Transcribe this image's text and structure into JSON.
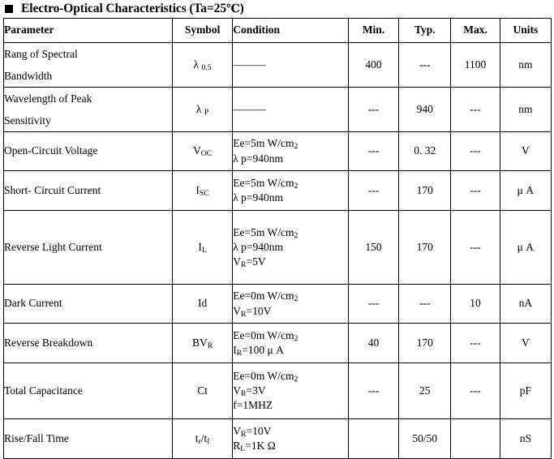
{
  "title": {
    "bullet": "black-square-bullet",
    "text": "Electro-Optical Characteristics (Ta=25℃)",
    "main": "Electro-Optical Characteristics (Ta=25",
    "temp_unit": "℃",
    "close_paren": ")"
  },
  "table": {
    "columns": [
      "Parameter",
      "Symbol",
      "Condition",
      "Min.",
      "Typ.",
      "Max.",
      "Units"
    ],
    "rows": [
      {
        "parameter_lines": [
          "Rang of Spectral",
          "Bandwidth"
        ],
        "symbol_html": "λ <sub>0.5</sub>",
        "symbol_text": "λ 0.5",
        "condition_lines": [
          "———"
        ],
        "min": "400",
        "typ": "---",
        "max": "1100",
        "units": "nm"
      },
      {
        "parameter_lines": [
          "Wavelength of Peak",
          "Sensitivity"
        ],
        "symbol_html": "λ <sub>P</sub>",
        "symbol_text": "λ P",
        "condition_lines": [
          "———"
        ],
        "min": "---",
        "typ": "940",
        "max": "---",
        "units": "nm"
      },
      {
        "parameter_lines": [
          "Open-Circuit Voltage"
        ],
        "symbol_html": "V<sub>OC</sub>",
        "symbol_text": "VOC",
        "condition_lines": [
          "Ee=5m W/cm<sub>2</sub>",
          "λ p=940nm"
        ],
        "min": "---",
        "typ": "0. 32",
        "max": "---",
        "units": "V"
      },
      {
        "parameter_lines": [
          "Short- Circuit Current"
        ],
        "symbol_html": "I<sub>SC</sub>",
        "symbol_text": "ISC",
        "condition_lines": [
          "Ee=5m W/cm<sub>2</sub>",
          "λ p=940nm"
        ],
        "min": "---",
        "typ": "170",
        "max": "---",
        "units": "μ A"
      },
      {
        "parameter_lines": [
          "Reverse Light Current"
        ],
        "symbol_html": "I<sub>L</sub>",
        "symbol_text": "IL",
        "condition_lines": [
          "Ee=5m W/cm<sub>2</sub>",
          "λ p=940nm",
          "V<sub>R</sub>=5V"
        ],
        "min": "150",
        "typ": "170",
        "max": "---",
        "units": "μ A"
      },
      {
        "parameter_lines": [
          "Dark Current"
        ],
        "symbol_html": "Id",
        "symbol_text": "Id",
        "condition_lines": [
          "Ee=0m W/cm<sub>2</sub>",
          "V<sub>R</sub>=10V"
        ],
        "min": "---",
        "typ": "---",
        "max": "10",
        "units": "nA"
      },
      {
        "parameter_lines": [
          "Reverse Breakdown"
        ],
        "symbol_html": "BV<sub>R</sub>",
        "symbol_text": "BVR",
        "condition_lines": [
          "Ee=0m W/cm<sub>2</sub>",
          "I<sub>R</sub>=100 μ A"
        ],
        "min": "40",
        "typ": "170",
        "max": "---",
        "units": "V"
      },
      {
        "parameter_lines": [
          "Total Capacitance"
        ],
        "symbol_html": "Ct",
        "symbol_text": "Ct",
        "condition_lines": [
          "Ee=0m W/cm<sub>2</sub>",
          "V<sub>R</sub>=3V",
          "f=1MHZ"
        ],
        "min": "---",
        "typ": "25",
        "max": "---",
        "units": "pF"
      },
      {
        "parameter_lines": [
          "Rise/Fall Time"
        ],
        "symbol_html": "t<sub>r</sub>/t<sub>f</sub>",
        "symbol_text": "tr/tf",
        "condition_lines": [
          "V<sub>R</sub>=10V",
          "R<sub>L</sub>=1K Ω"
        ],
        "min": "",
        "typ": "50/50",
        "max": "",
        "units": "nS"
      }
    ]
  },
  "colors": {
    "text": "#000000",
    "background": "#ffffff",
    "border": "#000000"
  }
}
